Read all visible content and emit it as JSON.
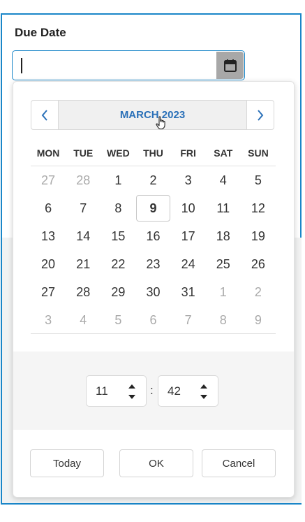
{
  "field": {
    "label": "Due Date",
    "value": ""
  },
  "calendar": {
    "month_title": "MARCH 2023",
    "weekdays": [
      "MON",
      "TUE",
      "WED",
      "THU",
      "FRI",
      "SAT",
      "SUN"
    ],
    "days": [
      {
        "d": "27",
        "other": true
      },
      {
        "d": "28",
        "other": true
      },
      {
        "d": "1"
      },
      {
        "d": "2"
      },
      {
        "d": "3"
      },
      {
        "d": "4"
      },
      {
        "d": "5"
      },
      {
        "d": "6"
      },
      {
        "d": "7"
      },
      {
        "d": "8"
      },
      {
        "d": "9",
        "selected": true
      },
      {
        "d": "10"
      },
      {
        "d": "11"
      },
      {
        "d": "12"
      },
      {
        "d": "13"
      },
      {
        "d": "14"
      },
      {
        "d": "15"
      },
      {
        "d": "16"
      },
      {
        "d": "17"
      },
      {
        "d": "18"
      },
      {
        "d": "19"
      },
      {
        "d": "20"
      },
      {
        "d": "21"
      },
      {
        "d": "22"
      },
      {
        "d": "23"
      },
      {
        "d": "24"
      },
      {
        "d": "25"
      },
      {
        "d": "26"
      },
      {
        "d": "27"
      },
      {
        "d": "28"
      },
      {
        "d": "29"
      },
      {
        "d": "30"
      },
      {
        "d": "31"
      },
      {
        "d": "1",
        "other": true
      },
      {
        "d": "2",
        "other": true
      },
      {
        "d": "3",
        "other": true
      },
      {
        "d": "4",
        "other": true
      },
      {
        "d": "5",
        "other": true
      },
      {
        "d": "6",
        "other": true
      },
      {
        "d": "7",
        "other": true
      },
      {
        "d": "8",
        "other": true
      },
      {
        "d": "9",
        "other": true
      }
    ]
  },
  "time": {
    "hour": "11",
    "minute": "42",
    "separator": ":"
  },
  "buttons": {
    "today": "Today",
    "ok": "OK",
    "cancel": "Cancel"
  },
  "icons": {
    "calendar": "calendar-icon",
    "prev": "chevron-left-icon",
    "next": "chevron-right-icon",
    "spin_up": "caret-up-icon",
    "spin_down": "caret-down-icon",
    "cursor": "hand-pointer-icon"
  },
  "colors": {
    "accent": "#1a86c8",
    "month_title": "#2a70b8",
    "icon_button_bg": "#a8a8a8"
  }
}
